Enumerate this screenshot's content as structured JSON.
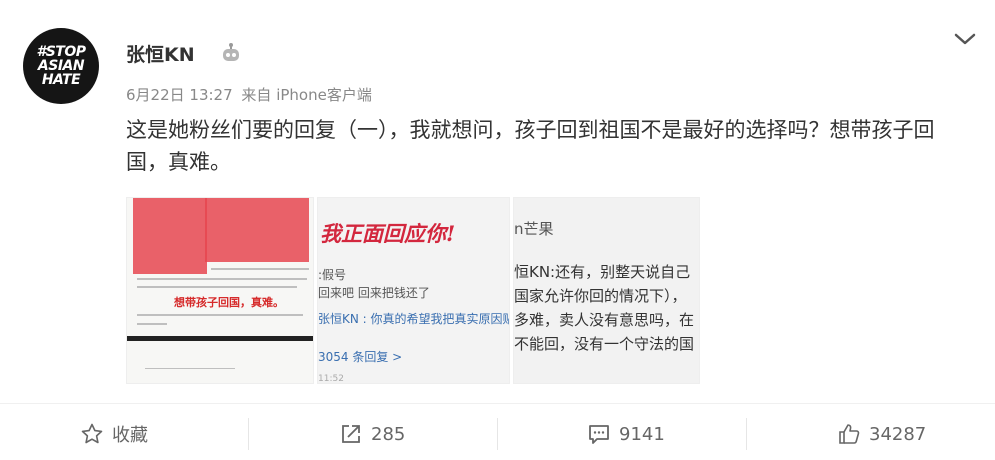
{
  "post": {
    "avatar_lines": [
      "#STOP",
      "ASIAN",
      "HATE"
    ],
    "username": "张恒KN",
    "badge_icon": "robot-badge-icon",
    "time": "6月22日 13:27",
    "source": "来自 iPhone客户端",
    "text": "这是她粉丝们要的回复（一），我就想问，孩子回到祖国不是最好的选择吗？想带孩子回国，真难。"
  },
  "images": {
    "img1_caption": "想带孩子回国，真难。",
    "img2_header": "我正面回应你!",
    "img2_lines": [
      ":假号",
      "回来吧 回来把钱还了",
      "张恒KN : 你真的希望我把真实原因贴",
      "3054 条回复 >",
      "11:52"
    ],
    "img3_lines": [
      "n芒果",
      "恒KN:还有，别整天说自己",
      "国家允许你回的情况下），",
      "多难，卖人没有意思吗，在",
      "不能回，没有一个守法的国"
    ]
  },
  "actions": {
    "favorite": "收藏",
    "share": "285",
    "comment": "9141",
    "like": "34287"
  },
  "colors": {
    "accent_red": "#d3273e",
    "text": "#333333",
    "muted": "#888888"
  }
}
